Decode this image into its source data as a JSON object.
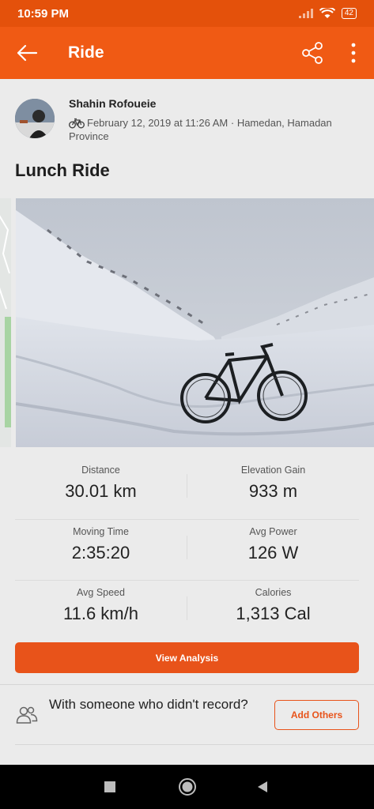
{
  "status_bar": {
    "time": "10:59 PM",
    "battery": "42"
  },
  "app_bar": {
    "title": "Ride"
  },
  "activity": {
    "athlete_name": "Shahin Rofoueie",
    "meta_line": "February 12, 2019 at 11:26 AM · Hamedan, Hamadan Province",
    "title": "Lunch Ride"
  },
  "stats": [
    {
      "label": "Distance",
      "value": "30.01 km"
    },
    {
      "label": "Elevation Gain",
      "value": "933 m"
    },
    {
      "label": "Moving Time",
      "value": "2:35:20"
    },
    {
      "label": "Avg Power",
      "value": "126 W"
    },
    {
      "label": "Avg Speed",
      "value": "11.6 km/h"
    },
    {
      "label": "Calories",
      "value": "1,313 Cal"
    }
  ],
  "actions": {
    "view_analysis": "View Analysis",
    "with_someone": "With someone who didn't record?",
    "add_others": "Add Others"
  },
  "icons": {
    "back": "arrow-left-icon",
    "share": "share-icon",
    "more": "more-vertical-icon",
    "bike": "bicycle-icon",
    "people": "people-icon"
  },
  "colors": {
    "status_bar": "#e4510b",
    "app_bar": "#f05a14",
    "accent": "#e8531a",
    "background": "#ebebeb"
  }
}
